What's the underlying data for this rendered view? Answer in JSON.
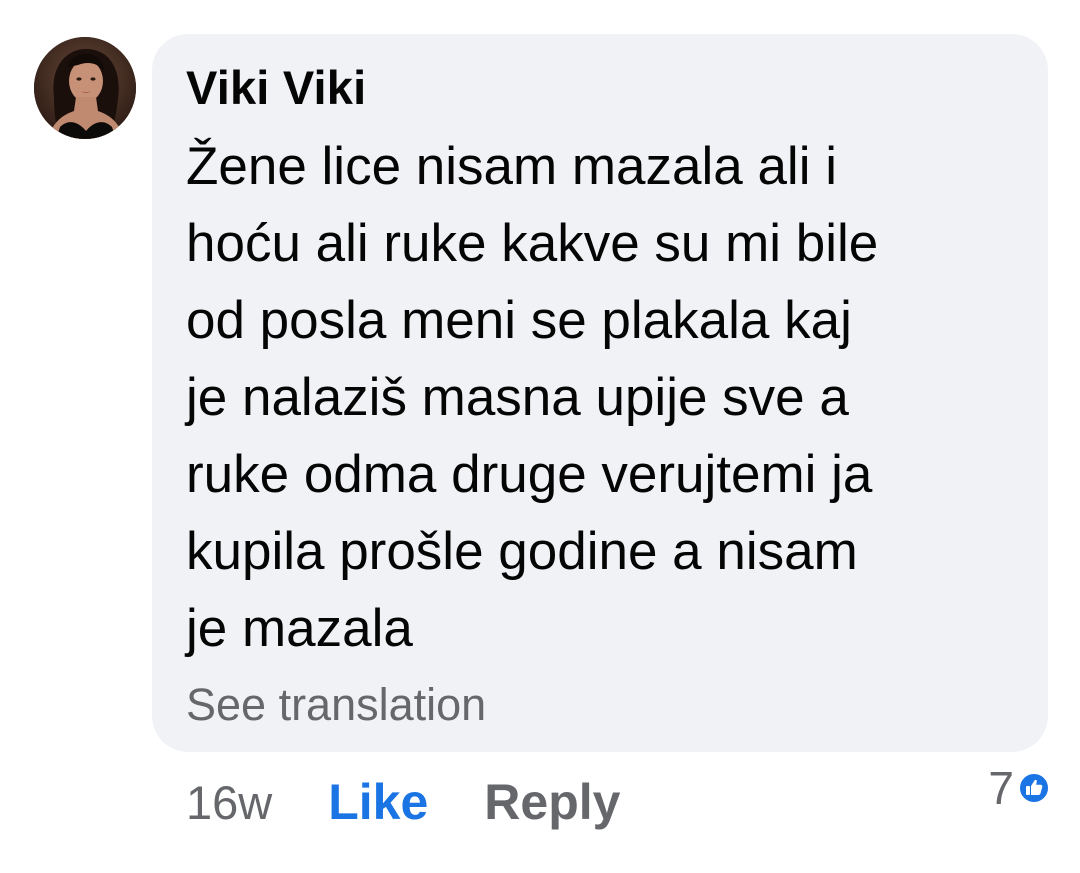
{
  "comment": {
    "author": "Viki Viki",
    "text_lines": [
      "Žene lice nisam mazala ali i",
      "hoću ali ruke kakve su mi bile",
      "od posla meni se plakala kaj",
      "je nalaziš masna upije sve a",
      "ruke odma druge verujtemi ja",
      "kupila prošle godine a nisam",
      "je mazala"
    ],
    "see_translation": "See translation",
    "timestamp": "16w",
    "like_label": "Like",
    "reply_label": "Reply",
    "reaction_count": "7",
    "reaction_icon": "like-thumb-icon"
  },
  "colors": {
    "bubble_bg": "#f0f2f5",
    "text": "#050505",
    "secondary_text": "#65676b",
    "like_blue": "#1b74e4"
  }
}
